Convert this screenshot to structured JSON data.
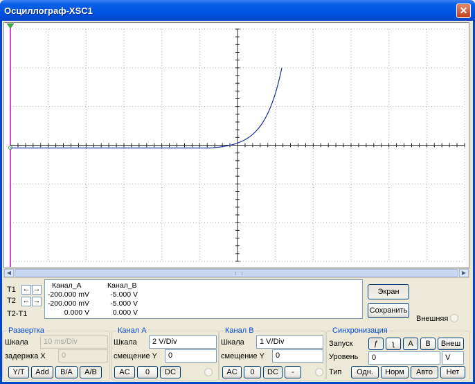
{
  "window": {
    "title": "Осциллограф-XSC1",
    "close_glyph": "✕"
  },
  "colors": {
    "trace": "#1A2BA0",
    "cursor_t1": "#CC00CC",
    "grid": "#A0A0A0",
    "title_blue": "#0054E3"
  },
  "icons": {
    "trigger_marker": "trigger-triangle-icon"
  },
  "cursors": {
    "t1": "T1",
    "t2": "T2",
    "t2_t1": "T2-T1",
    "left_arrow": "←",
    "right_arrow": "→"
  },
  "readout": {
    "col_a": "Канал_A",
    "col_b": "Канал_B",
    "rows": [
      {
        "a": "-200.000 mV",
        "b": "-5.000 V"
      },
      {
        "a": "-200.000 mV",
        "b": "-5.000 V"
      },
      {
        "a": "0.000 V",
        "b": "0.000 V"
      }
    ]
  },
  "buttons": {
    "screen": "Экран",
    "save": "Сохранить"
  },
  "external_label": "Внешняя",
  "timebase": {
    "title": "Развертка",
    "scale_label": "Шкала",
    "scale_value": "10 ms/Div",
    "delay_label": "задержка X",
    "delay_value": "0",
    "modes": [
      "Y/T",
      "Add",
      "B/A",
      "A/B"
    ]
  },
  "channel_a": {
    "title": "Канал A",
    "scale_label": "Шкала",
    "scale_value": "2  V/Div",
    "offset_label": "смещение Y",
    "offset_value": "0",
    "coupling": [
      "AC",
      "0",
      "DC"
    ]
  },
  "channel_b": {
    "title": "Канал B",
    "scale_label": "Шкала",
    "scale_value": "1  V/Div",
    "offset_label": "смещение Y",
    "offset_value": "0",
    "coupling": [
      "AC",
      "0",
      "DC",
      "-"
    ]
  },
  "trigger": {
    "title": "Синхронизация",
    "edge_label": "Запуск",
    "edge_rise": "ƒ",
    "edge_fall": "ʅ",
    "sources": [
      "A",
      "B",
      "Внеш"
    ],
    "level_label": "Уровень",
    "level_value": "0",
    "level_unit": "V",
    "type_label": "Тип",
    "types": [
      "Одн.",
      "Норм",
      "Авто",
      "Нет"
    ]
  }
}
